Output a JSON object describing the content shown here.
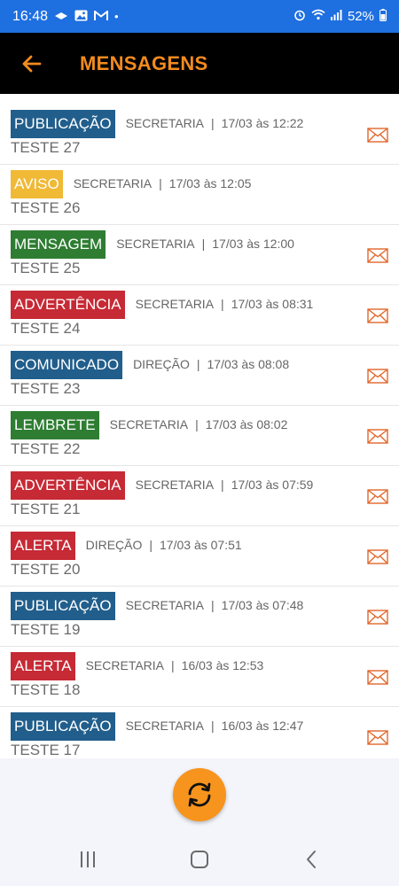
{
  "status_bar": {
    "time": "16:48",
    "dot": "•",
    "battery": "52%",
    "icons_left": [
      "message-icon",
      "image-icon",
      "gmail-icon"
    ],
    "icons_right": [
      "alarm-icon",
      "wifi-icon",
      "signal-icon",
      "battery-icon"
    ]
  },
  "header": {
    "title": "MENSAGENS",
    "back_icon": "arrow-left-icon"
  },
  "colors": {
    "accent": "#f28b1e",
    "status_bar": "#1e6fe0",
    "publicacao": "#215e8c",
    "aviso": "#f0b936",
    "mensagem": "#2e7d32",
    "advertencia": "#c62a35",
    "comunicado": "#215e8c",
    "lembrete": "#2e7d32",
    "alerta": "#c62a35"
  },
  "messages": [
    {
      "category": "PUBLICAÇÃO",
      "color": "#215e8c",
      "sender": "SECRETARIA",
      "date": "17/03 às 12:22",
      "title": "TESTE 27",
      "mail_icon": true
    },
    {
      "category": "AVISO",
      "color": "#f0b936",
      "sender": "SECRETARIA",
      "date": "17/03 às 12:05",
      "title": "TESTE 26",
      "mail_icon": false
    },
    {
      "category": "MENSAGEM",
      "color": "#2e7d32",
      "sender": "SECRETARIA",
      "date": "17/03 às 12:00",
      "title": "TESTE 25",
      "mail_icon": true
    },
    {
      "category": "ADVERTÊNCIA",
      "color": "#c62a35",
      "sender": "SECRETARIA",
      "date": "17/03 às 08:31",
      "title": "TESTE 24",
      "mail_icon": true
    },
    {
      "category": "COMUNICADO",
      "color": "#215e8c",
      "sender": "DIREÇÃO",
      "date": "17/03 às 08:08",
      "title": "TESTE 23",
      "mail_icon": true
    },
    {
      "category": "LEMBRETE",
      "color": "#2e7d32",
      "sender": "SECRETARIA",
      "date": "17/03 às 08:02",
      "title": "TESTE 22",
      "mail_icon": true
    },
    {
      "category": "ADVERTÊNCIA",
      "color": "#c62a35",
      "sender": "SECRETARIA",
      "date": "17/03 às 07:59",
      "title": "TESTE 21",
      "mail_icon": true
    },
    {
      "category": "ALERTA",
      "color": "#c62a35",
      "sender": "DIREÇÃO",
      "date": "17/03 às 07:51",
      "title": "TESTE 20",
      "mail_icon": true
    },
    {
      "category": "PUBLICAÇÃO",
      "color": "#215e8c",
      "sender": "SECRETARIA",
      "date": "17/03 às 07:48",
      "title": "TESTE 19",
      "mail_icon": true
    },
    {
      "category": "ALERTA",
      "color": "#c62a35",
      "sender": "SECRETARIA",
      "date": "16/03 às 12:53",
      "title": "TESTE 18",
      "mail_icon": true
    },
    {
      "category": "PUBLICAÇÃO",
      "color": "#215e8c",
      "sender": "SECRETARIA",
      "date": "16/03 às 12:47",
      "title": "TESTE 17",
      "mail_icon": true
    }
  ],
  "meta_separator": "|",
  "refresh": {
    "icon": "refresh-icon"
  },
  "navbar": {
    "icons": [
      "recent-apps-icon",
      "home-icon",
      "back-icon"
    ]
  }
}
